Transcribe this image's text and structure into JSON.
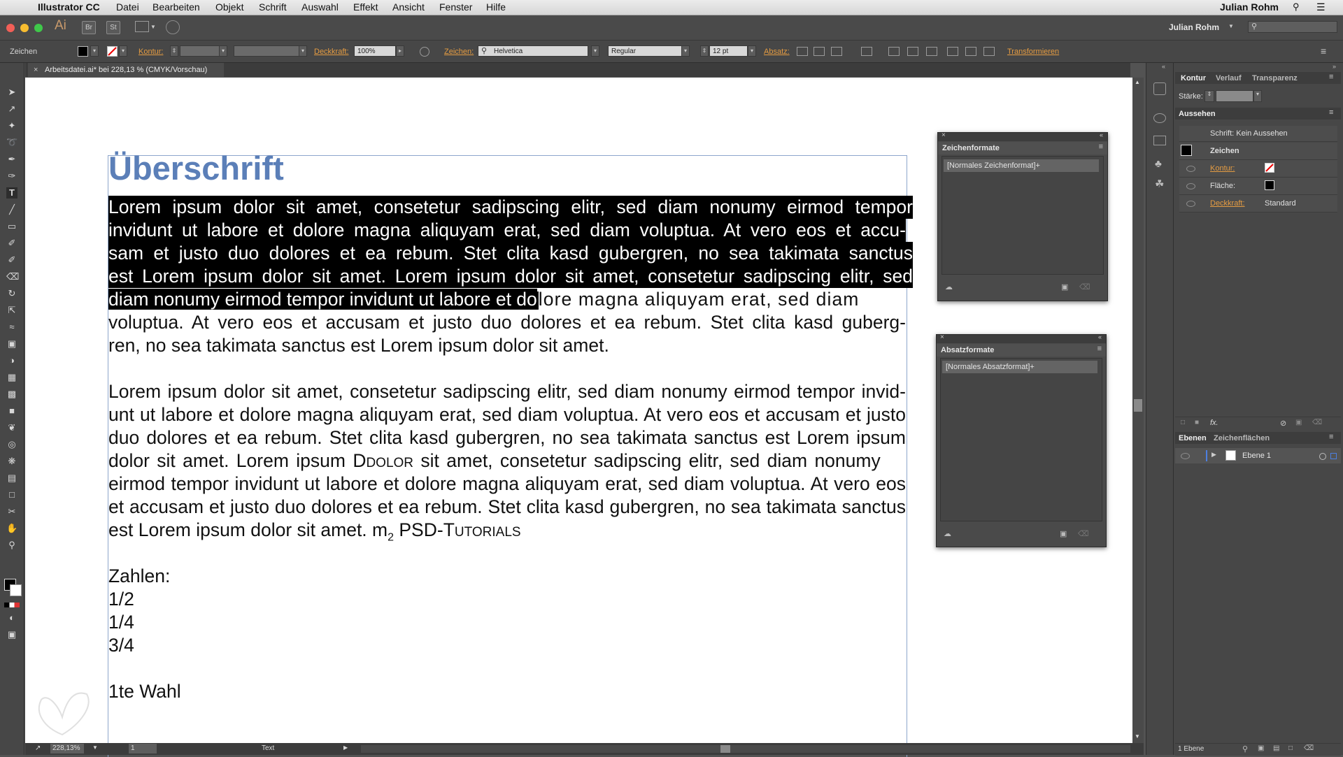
{
  "menubar": {
    "app": "Illustrator CC",
    "items": [
      "Datei",
      "Bearbeiten",
      "Objekt",
      "Schrift",
      "Auswahl",
      "Effekt",
      "Ansicht",
      "Fenster",
      "Hilfe"
    ],
    "user": "Julian Rohm"
  },
  "appbar": {
    "logo": "Ai",
    "btn_br": "Br",
    "btn_st": "St",
    "workspace_user": "Julian Rohm"
  },
  "control": {
    "mode_label": "Zeichen",
    "kontur_label": "Kontur:",
    "deckkraft_label": "Deckkraft:",
    "deckkraft_value": "100%",
    "zeichen_label": "Zeichen:",
    "font": "Helvetica",
    "style": "Regular",
    "size": "12 pt",
    "absatz_label": "Absatz:",
    "transform_label": "Transformieren"
  },
  "document": {
    "tab_title": "Arbeitsdatei.ai* bei 228,13 % (CMYK/Vorschau)",
    "heading": "Überschrift",
    "para1": [
      "Lorem ipsum dolor sit amet, consetetur sadipscing elitr, sed diam nonumy eirmod tempor",
      "invidunt ut labore et dolore magna aliquyam erat, sed diam voluptua. At vero eos et accu-",
      "sam et justo duo dolores et ea rebum. Stet clita kasd gubergren, no sea takimata sanctus",
      "est Lorem ipsum dolor sit amet. Lorem ipsum dolor sit amet, consetetur sadipscing elitr, sed"
    ],
    "para1_line5_selected": "diam nonumy eirmod tempor invidunt ut labore et do",
    "para1_line5_rest": "lore magna aliquyam erat, sed diam",
    "para1_tail": [
      "voluptua. At vero eos et accusam et justo duo dolores et ea rebum. Stet clita kasd guberg-",
      "ren, no sea takimata sanctus est Lorem ipsum dolor sit amet."
    ],
    "para2": [
      "Lorem ipsum dolor sit amet, consetetur sadipscing elitr, sed diam nonumy eirmod tempor invid-",
      "unt ut labore et dolore magna aliquyam erat, sed diam voluptua. At vero eos et accusam et justo",
      "duo dolores et ea rebum. Stet clita kasd gubergren, no sea takimata sanctus est Lorem ipsum"
    ],
    "para2_line4_a": "dolor sit amet. Lorem ipsum ",
    "para2_line4_dolor": "Ddolor",
    "para2_line4_b": " sit amet, consetetur sadipscing elitr, sed diam nonumy",
    "para2_more": [
      "eirmod tempor invidunt ut labore et dolore magna aliquyam erat, sed diam voluptua. At vero eos",
      "et accusam et justo duo dolores et ea rebum. Stet clita kasd gubergren, no sea takimata sanctus"
    ],
    "para2_last_a": "est Lorem ipsum dolor sit amet. m",
    "para2_last_sub": "2",
    "para2_last_b": " PSD-",
    "para2_last_smallcaps": "Tutorials",
    "numbers": [
      "Zahlen:",
      "1/2",
      "1/4",
      "3/4"
    ],
    "final": "1te Wahl"
  },
  "panels": {
    "zeichenformate": {
      "title": "Zeichenformate",
      "item": "[Normales Zeichenformat]+"
    },
    "absatzformate": {
      "title": "Absatzformate",
      "item": "[Normales Absatzformat]+"
    }
  },
  "rightdock": {
    "tabs1": [
      "Kontur",
      "Verlauf",
      "Transparenz"
    ],
    "staerke_label": "Stärke:",
    "aussehen_title": "Aussehen",
    "aussehen_header": "Schrift: Kein Aussehen",
    "zeichen_row": "Zeichen",
    "kontur_row": "Kontur:",
    "flaeche_row": "Fläche:",
    "deckkraft_row": "Deckkraft:",
    "deckkraft_val": "Standard",
    "fx": "fx.",
    "tabs2": [
      "Ebenen",
      "Zeichenflächen"
    ],
    "layer": "Ebene 1",
    "layer_count": "1 Ebene"
  },
  "status": {
    "zoom": "228,13%",
    "page": "1",
    "tool": "Text"
  }
}
